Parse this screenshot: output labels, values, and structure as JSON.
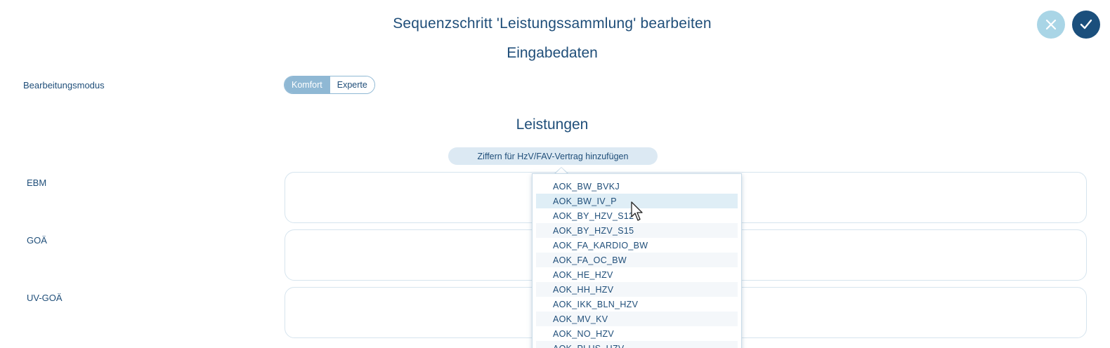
{
  "header": {
    "title": "Sequenzschritt 'Leistungssammlung' bearbeiten",
    "subtitle": "Eingabedaten",
    "cancel_icon": "close-icon",
    "confirm_icon": "check-icon"
  },
  "mode": {
    "label": "Bearbeitungsmodus",
    "options": [
      "Komfort",
      "Experte"
    ],
    "selected": "Komfort"
  },
  "services": {
    "title": "Leistungen",
    "add_button": "Ziffern für HzV/FAV-Vertrag hinzufügen",
    "fields": [
      {
        "label": "EBM",
        "value": ""
      },
      {
        "label": "GOÄ",
        "value": ""
      },
      {
        "label": "UV-GOÄ",
        "value": ""
      }
    ]
  },
  "dropdown": {
    "items": [
      "AOK_BW_BVKJ",
      "AOK_BW_IV_P",
      "AOK_BY_HZV_S12",
      "AOK_BY_HZV_S15",
      "AOK_FA_KARDIO_BW",
      "AOK_FA_OC_BW",
      "AOK_HE_HZV",
      "AOK_HH_HZV",
      "AOK_IKK_BLN_HZV",
      "AOK_MV_KV",
      "AOK_NO_HZV",
      "AOK_PLUS_HZV"
    ],
    "hovered": "AOK_BW_IV_P"
  },
  "colors": {
    "primary": "#1b4f7c",
    "accent_light": "#a9d5e6",
    "toggle_active": "#8fb8d4",
    "hover_row": "#dfeef6"
  }
}
